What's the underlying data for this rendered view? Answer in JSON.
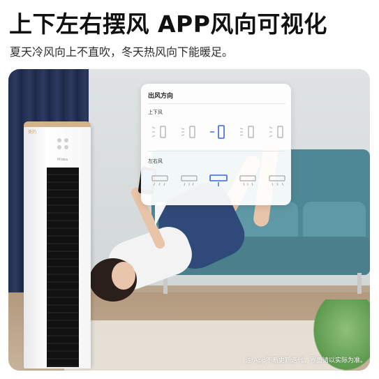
{
  "headline": "上下左右摆风 APP风向可视化",
  "subline": "夏天冷风向上不直吹，冬天热风向下能暖足。",
  "panel": {
    "title": "出风方向",
    "vertical": {
      "label": "上下风",
      "options": [
        "vertical-position-1",
        "vertical-position-2",
        "vertical-position-3",
        "vertical-position-4",
        "vertical-position-5"
      ],
      "selected_index": 2
    },
    "horizontal": {
      "label": "左右风",
      "options": [
        "horizontal-position-1",
        "horizontal-position-2",
        "horizontal-position-3",
        "horizontal-position-4",
        "horizontal-position-5"
      ],
      "selected_index": 2
    }
  },
  "ac_unit": {
    "logo": "美的",
    "brand": "Midea"
  },
  "disclaimer": "注:App不断更新迭代，界面请以实际为准。",
  "colors": {
    "selected": "#3a66e0",
    "unselected": "#a8a8a8",
    "panel_bg": "#ffffff"
  }
}
